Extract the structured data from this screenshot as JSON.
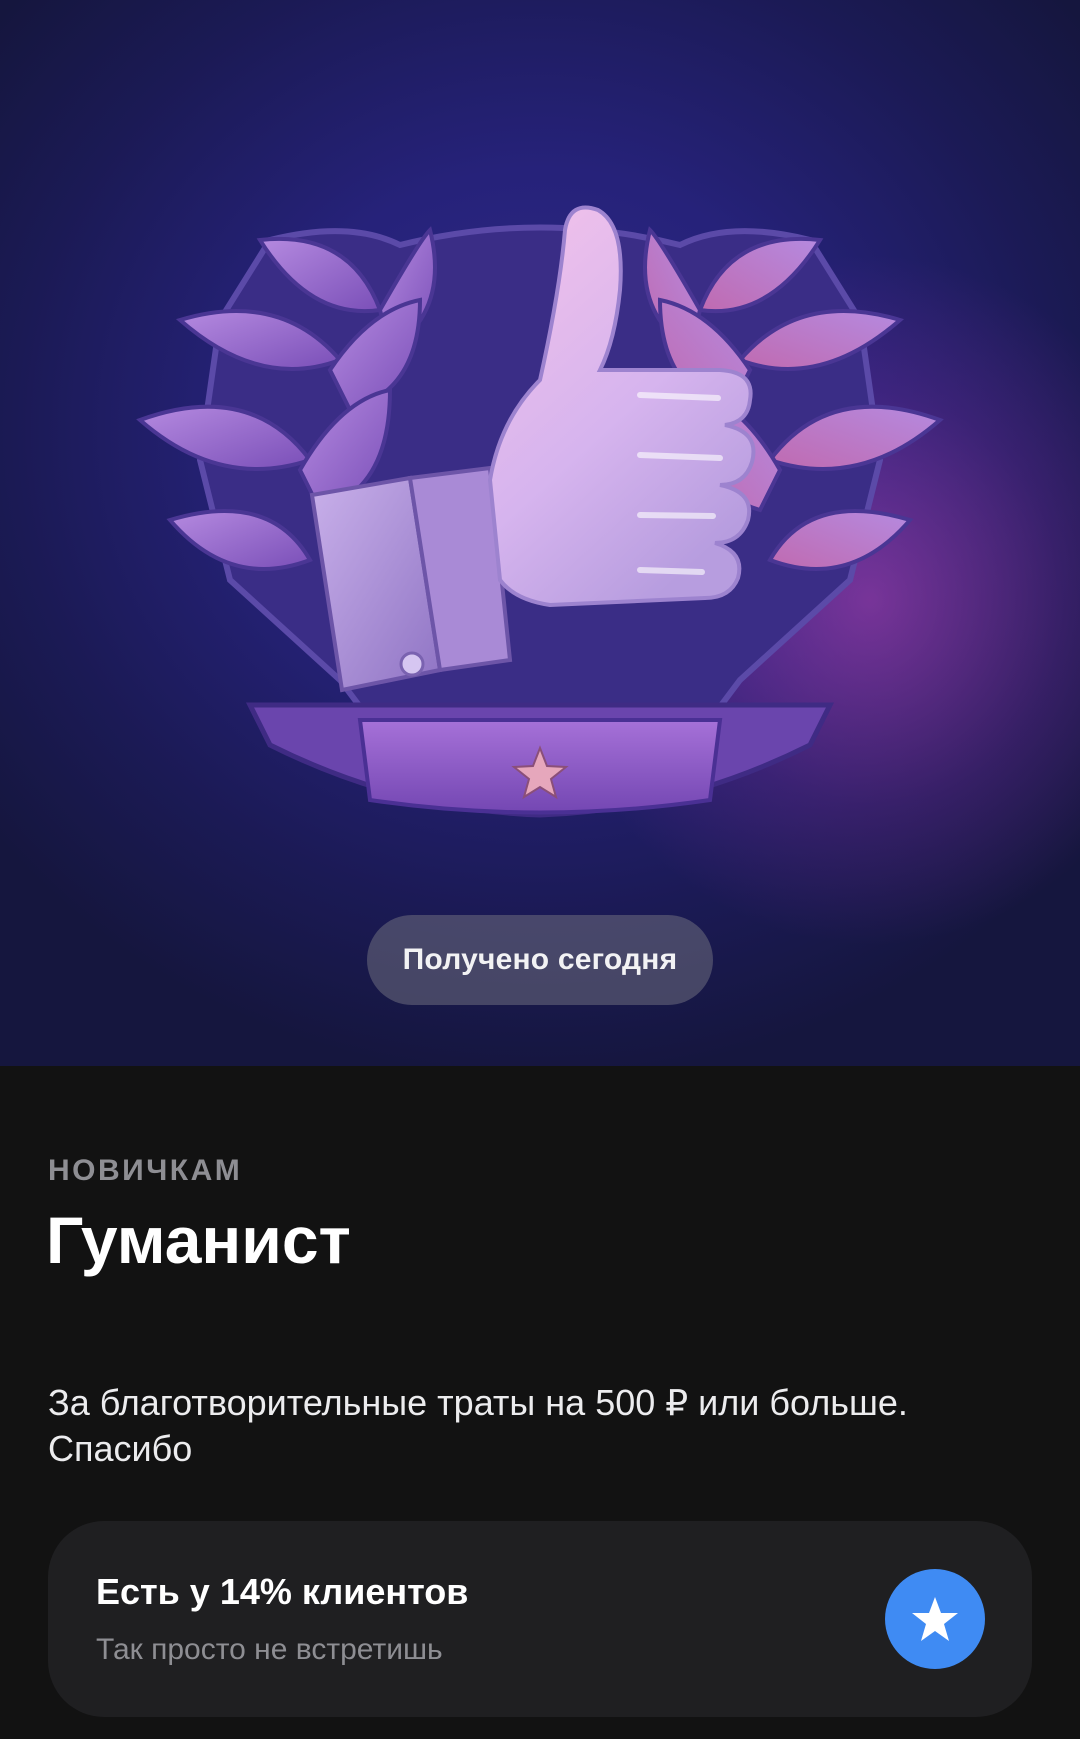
{
  "badge": {
    "status_label": "Получено сегодня",
    "category": "НОВИЧКАМ",
    "title": "Гуманист",
    "description": "За благотворительные траты на 500 ₽ или больше. Спасибо",
    "illustration_icon": "thumbs-up-emblem-icon"
  },
  "rarity": {
    "title": "Есть у 14% клиентов",
    "subtitle": "Так просто не встретишь",
    "icon": "star-icon",
    "percent": 14
  },
  "colors": {
    "accent_blue": "#3f8bf3",
    "background_dark": "#121212",
    "card_background": "#1f1f21",
    "hero_indigo": "#26227a",
    "hero_magenta_glow": "#be46be"
  }
}
